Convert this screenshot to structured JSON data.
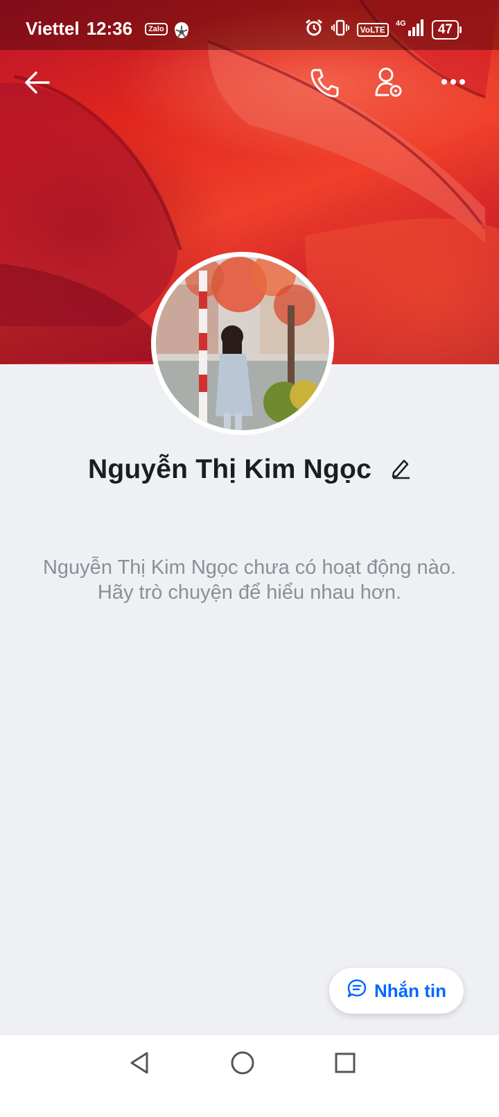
{
  "status_bar": {
    "carrier": "Viettel",
    "time": "12:36",
    "zalo_badge": "Zalo",
    "volte": "VoLTE",
    "network": "4G",
    "battery": "47"
  },
  "toolbar": {
    "back_icon": "back-arrow-icon",
    "call_icon": "phone-icon",
    "settings_icon": "user-settings-icon",
    "more_icon": "more-dots-icon"
  },
  "profile": {
    "name": "Nguyễn Thị Kim Ngọc",
    "edit_icon": "pencil-icon",
    "empty_message": "Nguyễn Thị Kim Ngọc chưa có hoạt động nào. Hãy trò chuyện để hiểu nhau hơn."
  },
  "actions": {
    "message_label": "Nhắn tin",
    "message_icon": "chat-bubble-icon"
  },
  "colors": {
    "accent": "#0068ff",
    "background": "#eff0f4",
    "cover_red": "#e0261f"
  }
}
